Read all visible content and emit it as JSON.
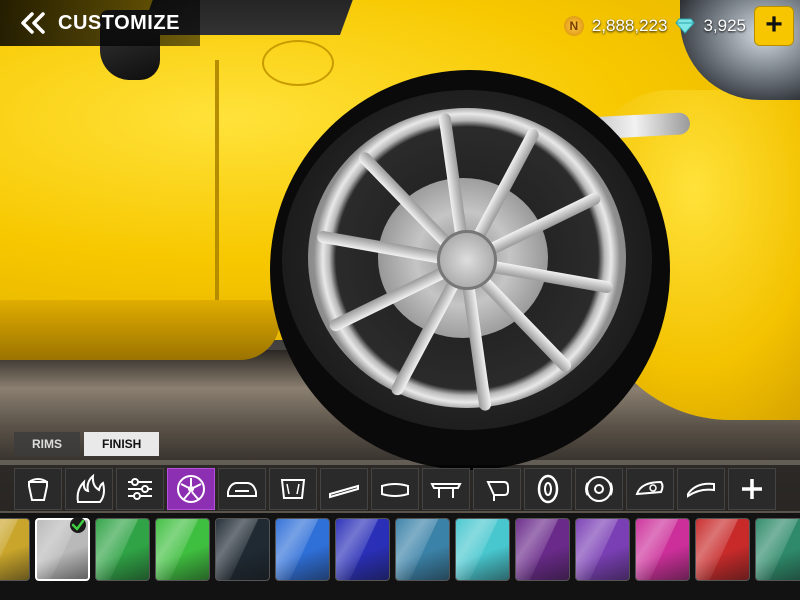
{
  "header": {
    "title": "CUSTOMIZE",
    "back_icon": "double-chevron-left-icon"
  },
  "currency": {
    "coins": "2,888,223",
    "gems": "3,925",
    "coin_symbol": "N"
  },
  "tabs": [
    {
      "label": "RIMS",
      "active": false
    },
    {
      "label": "FINISH",
      "active": true
    }
  ],
  "categories": [
    {
      "name": "paint-bucket-icon",
      "selected": false
    },
    {
      "name": "flames-livery-icon",
      "selected": false
    },
    {
      "name": "tuning-sliders-icon",
      "selected": false
    },
    {
      "name": "rim-icon",
      "selected": true
    },
    {
      "name": "front-bumper-icon",
      "selected": false
    },
    {
      "name": "hood-icon",
      "selected": false
    },
    {
      "name": "side-skirt-icon",
      "selected": false
    },
    {
      "name": "rear-bumper-icon",
      "selected": false
    },
    {
      "name": "spoiler-icon",
      "selected": false
    },
    {
      "name": "side-mirror-icon",
      "selected": false
    },
    {
      "name": "tire-icon",
      "selected": false
    },
    {
      "name": "brake-disc-icon",
      "selected": false
    },
    {
      "name": "headlight-icon",
      "selected": false
    },
    {
      "name": "roof-scoop-icon",
      "selected": false
    },
    {
      "name": "add-icon",
      "selected": false
    }
  ],
  "swatches": [
    {
      "color": "#c9a52b",
      "selected": false
    },
    {
      "color": "#b9b9b9",
      "selected": true
    },
    {
      "color": "#2fa345",
      "selected": false
    },
    {
      "color": "#3fbf3f",
      "selected": false
    },
    {
      "color": "#1f2a33",
      "selected": false
    },
    {
      "color": "#2f6fd8",
      "selected": false
    },
    {
      "color": "#2a2fb8",
      "selected": false
    },
    {
      "color": "#3b82a8",
      "selected": false
    },
    {
      "color": "#48c7cf",
      "selected": false
    },
    {
      "color": "#6a2a8a",
      "selected": false
    },
    {
      "color": "#7a3fb5",
      "selected": false
    },
    {
      "color": "#cc2f9a",
      "selected": false
    },
    {
      "color": "#c82a2a",
      "selected": false
    },
    {
      "color": "#2e8a6a",
      "selected": false
    }
  ],
  "colors": {
    "accent_yellow": "#f7c600",
    "selected_purple": "#8d2fb2",
    "check_green": "#3ecf3e"
  }
}
